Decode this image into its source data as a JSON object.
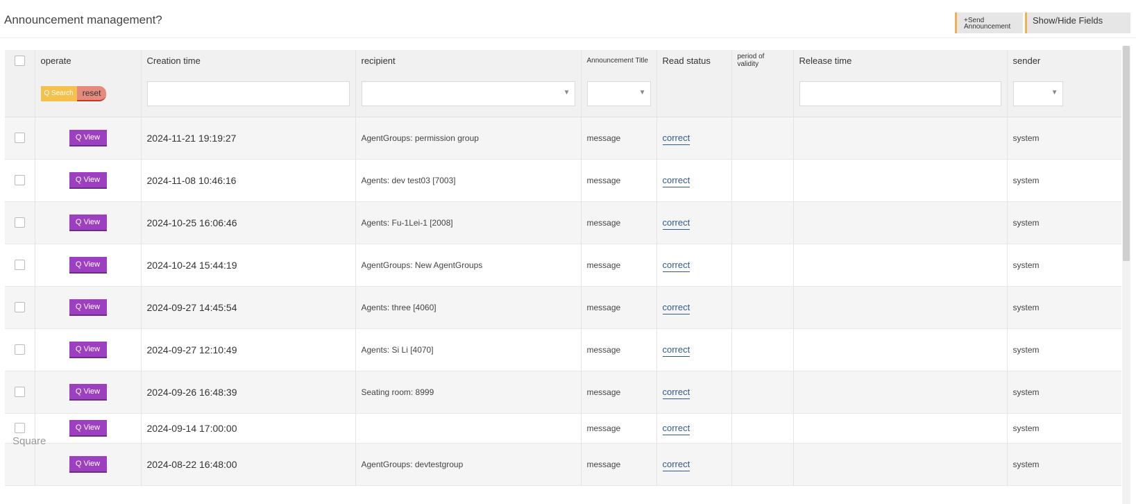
{
  "header": {
    "title": "Announcement management?",
    "send_button_label": "+Send Announcement",
    "fields_button_label": "Show/Hide Fields"
  },
  "table": {
    "columns": {
      "operate": "operate",
      "creation_time": "Creation time",
      "recipient": "recipient",
      "announcement_title": "Announcement Title",
      "read_status": "Read status",
      "period_of_validity": "period of validity",
      "release_time": "Release time",
      "sender": "sender"
    },
    "filters": {
      "search_label": "Q Search",
      "reset_label": "reset",
      "dropdown_caret": "▼"
    },
    "view_label": "Q View",
    "rows": [
      {
        "creation_time": "2024-11-21 19:19:27",
        "recipient": "AgentGroups: permission group",
        "title": "message",
        "read_status": "correct",
        "sender": "system"
      },
      {
        "creation_time": "2024-11-08 10:46:16",
        "recipient": "Agents: dev test03 [7003]",
        "title": "message",
        "read_status": "correct",
        "sender": "system"
      },
      {
        "creation_time": "2024-10-25 16:06:46",
        "recipient": "Agents: Fu-1Lei-1 [2008]",
        "title": "message",
        "read_status": "correct",
        "sender": "system"
      },
      {
        "creation_time": "2024-10-24 15:44:19",
        "recipient": "AgentGroups: New AgentGroups",
        "title": "message",
        "read_status": "correct",
        "sender": "system"
      },
      {
        "creation_time": "2024-09-27 14:45:54",
        "recipient": "Agents: three [4060]",
        "title": "message",
        "read_status": "correct",
        "sender": "system"
      },
      {
        "creation_time": "2024-09-27 12:10:49",
        "recipient": "Agents: Si Li [4070]",
        "title": "message",
        "read_status": "correct",
        "sender": "system"
      },
      {
        "creation_time": "2024-09-26 16:48:39",
        "recipient": "Seating room: 8999",
        "title": "message",
        "read_status": "correct",
        "sender": "system"
      },
      {
        "creation_time": "2024-09-14 17:00:00",
        "recipient": "",
        "title": "message",
        "read_status": "correct",
        "sender": "system"
      },
      {
        "creation_time": "2024-08-22 16:48:00",
        "recipient": "AgentGroups: devtestgroup",
        "title": "message",
        "read_status": "correct",
        "sender": "system"
      }
    ]
  },
  "overlay_label": "Square",
  "colors": {
    "accent_orange": "#f0b04f",
    "view_purple": "#9c3fc0",
    "search_yellow": "#f4c14d",
    "reset_red": "#e58b7e",
    "link_blue": "#2f5a8a"
  }
}
